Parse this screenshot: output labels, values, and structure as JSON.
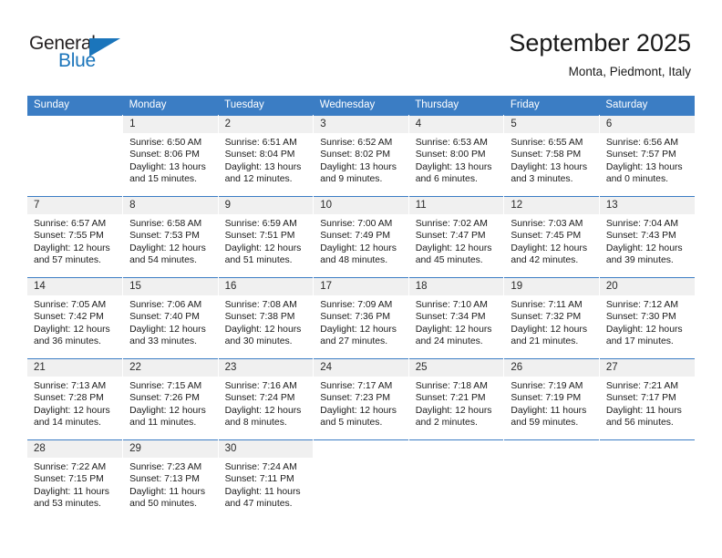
{
  "brand": {
    "name_part1": "General",
    "name_part2": "Blue",
    "accent_color": "#1b75bb"
  },
  "header": {
    "title": "September 2025",
    "subtitle": "Monta, Piedmont, Italy",
    "header_bg_color": "#3b7dc4",
    "daynum_bg_color": "#f0f0f0"
  },
  "weekday_headers": [
    "Sunday",
    "Monday",
    "Tuesday",
    "Wednesday",
    "Thursday",
    "Friday",
    "Saturday"
  ],
  "weeks": [
    [
      {
        "day": "",
        "sunrise": "",
        "sunset": "",
        "daylight1": "",
        "daylight2": ""
      },
      {
        "day": "1",
        "sunrise": "Sunrise: 6:50 AM",
        "sunset": "Sunset: 8:06 PM",
        "daylight1": "Daylight: 13 hours",
        "daylight2": "and 15 minutes."
      },
      {
        "day": "2",
        "sunrise": "Sunrise: 6:51 AM",
        "sunset": "Sunset: 8:04 PM",
        "daylight1": "Daylight: 13 hours",
        "daylight2": "and 12 minutes."
      },
      {
        "day": "3",
        "sunrise": "Sunrise: 6:52 AM",
        "sunset": "Sunset: 8:02 PM",
        "daylight1": "Daylight: 13 hours",
        "daylight2": "and 9 minutes."
      },
      {
        "day": "4",
        "sunrise": "Sunrise: 6:53 AM",
        "sunset": "Sunset: 8:00 PM",
        "daylight1": "Daylight: 13 hours",
        "daylight2": "and 6 minutes."
      },
      {
        "day": "5",
        "sunrise": "Sunrise: 6:55 AM",
        "sunset": "Sunset: 7:58 PM",
        "daylight1": "Daylight: 13 hours",
        "daylight2": "and 3 minutes."
      },
      {
        "day": "6",
        "sunrise": "Sunrise: 6:56 AM",
        "sunset": "Sunset: 7:57 PM",
        "daylight1": "Daylight: 13 hours",
        "daylight2": "and 0 minutes."
      }
    ],
    [
      {
        "day": "7",
        "sunrise": "Sunrise: 6:57 AM",
        "sunset": "Sunset: 7:55 PM",
        "daylight1": "Daylight: 12 hours",
        "daylight2": "and 57 minutes."
      },
      {
        "day": "8",
        "sunrise": "Sunrise: 6:58 AM",
        "sunset": "Sunset: 7:53 PM",
        "daylight1": "Daylight: 12 hours",
        "daylight2": "and 54 minutes."
      },
      {
        "day": "9",
        "sunrise": "Sunrise: 6:59 AM",
        "sunset": "Sunset: 7:51 PM",
        "daylight1": "Daylight: 12 hours",
        "daylight2": "and 51 minutes."
      },
      {
        "day": "10",
        "sunrise": "Sunrise: 7:00 AM",
        "sunset": "Sunset: 7:49 PM",
        "daylight1": "Daylight: 12 hours",
        "daylight2": "and 48 minutes."
      },
      {
        "day": "11",
        "sunrise": "Sunrise: 7:02 AM",
        "sunset": "Sunset: 7:47 PM",
        "daylight1": "Daylight: 12 hours",
        "daylight2": "and 45 minutes."
      },
      {
        "day": "12",
        "sunrise": "Sunrise: 7:03 AM",
        "sunset": "Sunset: 7:45 PM",
        "daylight1": "Daylight: 12 hours",
        "daylight2": "and 42 minutes."
      },
      {
        "day": "13",
        "sunrise": "Sunrise: 7:04 AM",
        "sunset": "Sunset: 7:43 PM",
        "daylight1": "Daylight: 12 hours",
        "daylight2": "and 39 minutes."
      }
    ],
    [
      {
        "day": "14",
        "sunrise": "Sunrise: 7:05 AM",
        "sunset": "Sunset: 7:42 PM",
        "daylight1": "Daylight: 12 hours",
        "daylight2": "and 36 minutes."
      },
      {
        "day": "15",
        "sunrise": "Sunrise: 7:06 AM",
        "sunset": "Sunset: 7:40 PM",
        "daylight1": "Daylight: 12 hours",
        "daylight2": "and 33 minutes."
      },
      {
        "day": "16",
        "sunrise": "Sunrise: 7:08 AM",
        "sunset": "Sunset: 7:38 PM",
        "daylight1": "Daylight: 12 hours",
        "daylight2": "and 30 minutes."
      },
      {
        "day": "17",
        "sunrise": "Sunrise: 7:09 AM",
        "sunset": "Sunset: 7:36 PM",
        "daylight1": "Daylight: 12 hours",
        "daylight2": "and 27 minutes."
      },
      {
        "day": "18",
        "sunrise": "Sunrise: 7:10 AM",
        "sunset": "Sunset: 7:34 PM",
        "daylight1": "Daylight: 12 hours",
        "daylight2": "and 24 minutes."
      },
      {
        "day": "19",
        "sunrise": "Sunrise: 7:11 AM",
        "sunset": "Sunset: 7:32 PM",
        "daylight1": "Daylight: 12 hours",
        "daylight2": "and 21 minutes."
      },
      {
        "day": "20",
        "sunrise": "Sunrise: 7:12 AM",
        "sunset": "Sunset: 7:30 PM",
        "daylight1": "Daylight: 12 hours",
        "daylight2": "and 17 minutes."
      }
    ],
    [
      {
        "day": "21",
        "sunrise": "Sunrise: 7:13 AM",
        "sunset": "Sunset: 7:28 PM",
        "daylight1": "Daylight: 12 hours",
        "daylight2": "and 14 minutes."
      },
      {
        "day": "22",
        "sunrise": "Sunrise: 7:15 AM",
        "sunset": "Sunset: 7:26 PM",
        "daylight1": "Daylight: 12 hours",
        "daylight2": "and 11 minutes."
      },
      {
        "day": "23",
        "sunrise": "Sunrise: 7:16 AM",
        "sunset": "Sunset: 7:24 PM",
        "daylight1": "Daylight: 12 hours",
        "daylight2": "and 8 minutes."
      },
      {
        "day": "24",
        "sunrise": "Sunrise: 7:17 AM",
        "sunset": "Sunset: 7:23 PM",
        "daylight1": "Daylight: 12 hours",
        "daylight2": "and 5 minutes."
      },
      {
        "day": "25",
        "sunrise": "Sunrise: 7:18 AM",
        "sunset": "Sunset: 7:21 PM",
        "daylight1": "Daylight: 12 hours",
        "daylight2": "and 2 minutes."
      },
      {
        "day": "26",
        "sunrise": "Sunrise: 7:19 AM",
        "sunset": "Sunset: 7:19 PM",
        "daylight1": "Daylight: 11 hours",
        "daylight2": "and 59 minutes."
      },
      {
        "day": "27",
        "sunrise": "Sunrise: 7:21 AM",
        "sunset": "Sunset: 7:17 PM",
        "daylight1": "Daylight: 11 hours",
        "daylight2": "and 56 minutes."
      }
    ],
    [
      {
        "day": "28",
        "sunrise": "Sunrise: 7:22 AM",
        "sunset": "Sunset: 7:15 PM",
        "daylight1": "Daylight: 11 hours",
        "daylight2": "and 53 minutes."
      },
      {
        "day": "29",
        "sunrise": "Sunrise: 7:23 AM",
        "sunset": "Sunset: 7:13 PM",
        "daylight1": "Daylight: 11 hours",
        "daylight2": "and 50 minutes."
      },
      {
        "day": "30",
        "sunrise": "Sunrise: 7:24 AM",
        "sunset": "Sunset: 7:11 PM",
        "daylight1": "Daylight: 11 hours",
        "daylight2": "and 47 minutes."
      },
      {
        "day": "",
        "sunrise": "",
        "sunset": "",
        "daylight1": "",
        "daylight2": ""
      },
      {
        "day": "",
        "sunrise": "",
        "sunset": "",
        "daylight1": "",
        "daylight2": ""
      },
      {
        "day": "",
        "sunrise": "",
        "sunset": "",
        "daylight1": "",
        "daylight2": ""
      },
      {
        "day": "",
        "sunrise": "",
        "sunset": "",
        "daylight1": "",
        "daylight2": ""
      }
    ]
  ]
}
